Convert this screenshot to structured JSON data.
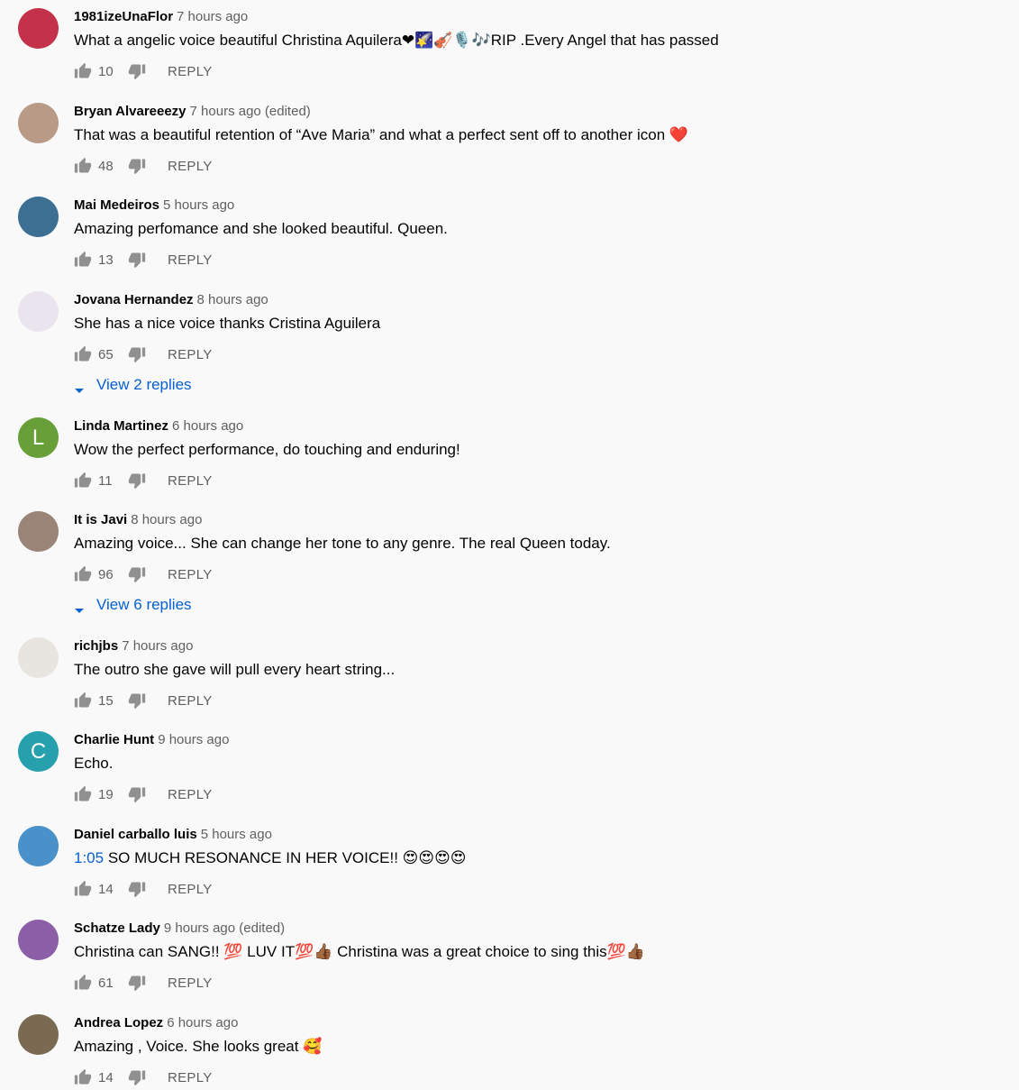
{
  "comments": [
    {
      "author": "1981izeUnaFlor",
      "time": "7 hours ago",
      "text": "What a angelic voice beautiful Christina Aquilera❤🌠🎻🎙️🎶RIP .Every Angel that has passed",
      "likes": "10",
      "reply_label": "REPLY",
      "avatar_color": "#c3324a"
    },
    {
      "author": "Bryan Alvareeezy",
      "time": "7 hours ago (edited)",
      "text": "That was a beautiful retention of “Ave Maria” and what a perfect sent off to another icon ❤️",
      "likes": "48",
      "reply_label": "REPLY",
      "avatar_color": "#b89a86"
    },
    {
      "author": "Mai Medeiros",
      "time": "5 hours ago",
      "text": "Amazing perfomance and she looked beautiful. Queen.",
      "likes": "13",
      "reply_label": "REPLY",
      "avatar_color": "#3d6f93"
    },
    {
      "author": "Jovana Hernandez",
      "time": "8 hours ago",
      "text": "She has a nice voice thanks Cristina Aguilera",
      "likes": "65",
      "reply_label": "REPLY",
      "avatar_color": "#e9e4ee",
      "view_replies": "View 2 replies"
    },
    {
      "author": "Linda Martinez",
      "time": "6 hours ago",
      "text": "Wow the perfect performance, do touching and enduring!",
      "likes": "11",
      "reply_label": "REPLY",
      "avatar_color": "#689f38",
      "avatar_letter": "L"
    },
    {
      "author": "It is Javi",
      "time": "8 hours ago",
      "text": "Amazing voice... She can change her tone to any genre. The real Queen today.",
      "likes": "96",
      "reply_label": "REPLY",
      "avatar_color": "#9a8478",
      "view_replies": "View 6 replies"
    },
    {
      "author": "richjbs",
      "time": "7 hours ago",
      "text": "The outro she gave will pull every heart string...",
      "likes": "15",
      "reply_label": "REPLY",
      "avatar_color": "#e8e4e0"
    },
    {
      "author": "Charlie Hunt",
      "time": "9 hours ago",
      "text": "Echo.",
      "likes": "19",
      "reply_label": "REPLY",
      "avatar_color": "#26a0ac",
      "avatar_letter": "C"
    },
    {
      "author": "Daniel carballo luis",
      "time": "5 hours ago",
      "timestamp_link": "1:05",
      "text": " SO MUCH RESONANCE IN HER VOICE!! 😍😍😍😍",
      "likes": "14",
      "reply_label": "REPLY",
      "avatar_color": "#4a90c9"
    },
    {
      "author": "Schatze Lady",
      "time": "9 hours ago (edited)",
      "text": "Christina can SANG!! 💯 LUV IT💯👍🏾 Christina was a great choice to sing this💯👍🏾",
      "likes": "61",
      "reply_label": "REPLY",
      "avatar_color": "#8c5ea8"
    },
    {
      "author": "Andrea Lopez",
      "time": "6 hours ago",
      "text": "Amazing , Voice. She looks great 🥰",
      "likes": "14",
      "reply_label": "REPLY",
      "avatar_color": "#7a6a52"
    }
  ]
}
